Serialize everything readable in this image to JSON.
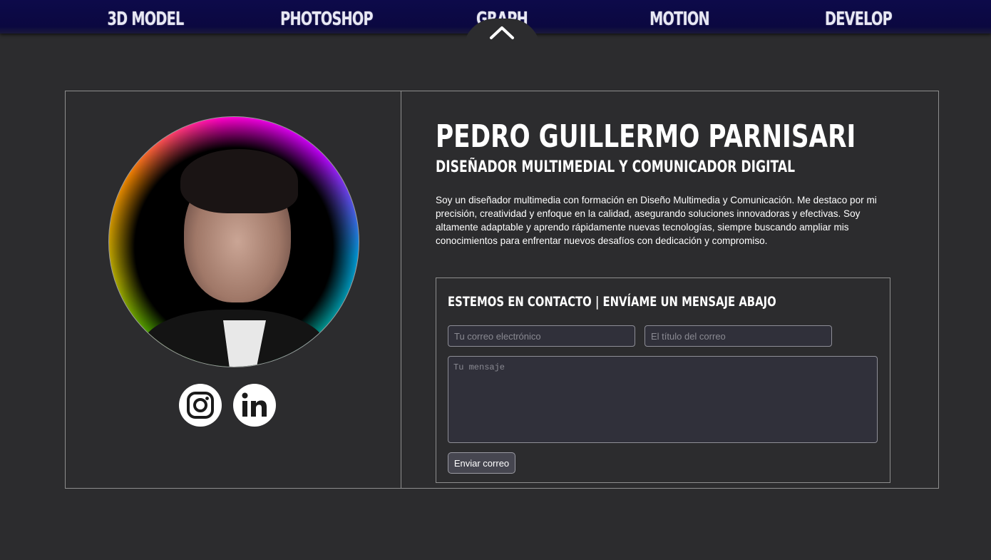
{
  "nav": {
    "items": [
      {
        "label": "3D MODEL"
      },
      {
        "label": "PHOTOSHOP"
      },
      {
        "label": "GRAPH"
      },
      {
        "label": "MOTION"
      },
      {
        "label": "DEVELOP"
      }
    ],
    "toggle_icon": "chevron-up-icon"
  },
  "profile": {
    "name": "PEDRO GUILLERMO PARNISARI",
    "role": "DISEÑADOR MULTIMEDIAL Y COMUNICADOR DIGITAL",
    "bio": "Soy un diseñador multimedia con formación en Diseño Multimedia y Comunicación. Me destaco por mi precisión, creatividad y enfoque en la calidad, asegurando soluciones innovadoras y efectivas. Soy altamente adaptable y aprendo rápidamente nuevas tecnologías, siempre buscando ampliar mis conocimientos para enfrentar nuevos desafíos con dedicación y compromiso.",
    "social": [
      {
        "icon": "instagram-icon"
      },
      {
        "icon": "linkedin-icon"
      }
    ]
  },
  "contact": {
    "title": "ESTEMOS EN CONTACTO | ENVÍAME UN MENSAJE ABAJO",
    "email_placeholder": "Tu correo electrónico",
    "subject_placeholder": "El título del correo",
    "message_placeholder": "Tu mensaje",
    "send_label": "Enviar correo"
  },
  "colors": {
    "page_bg": "#2c2c2e",
    "nav_bg": "#0b0840",
    "border": "#8e8e8e",
    "text": "#ffffff"
  }
}
